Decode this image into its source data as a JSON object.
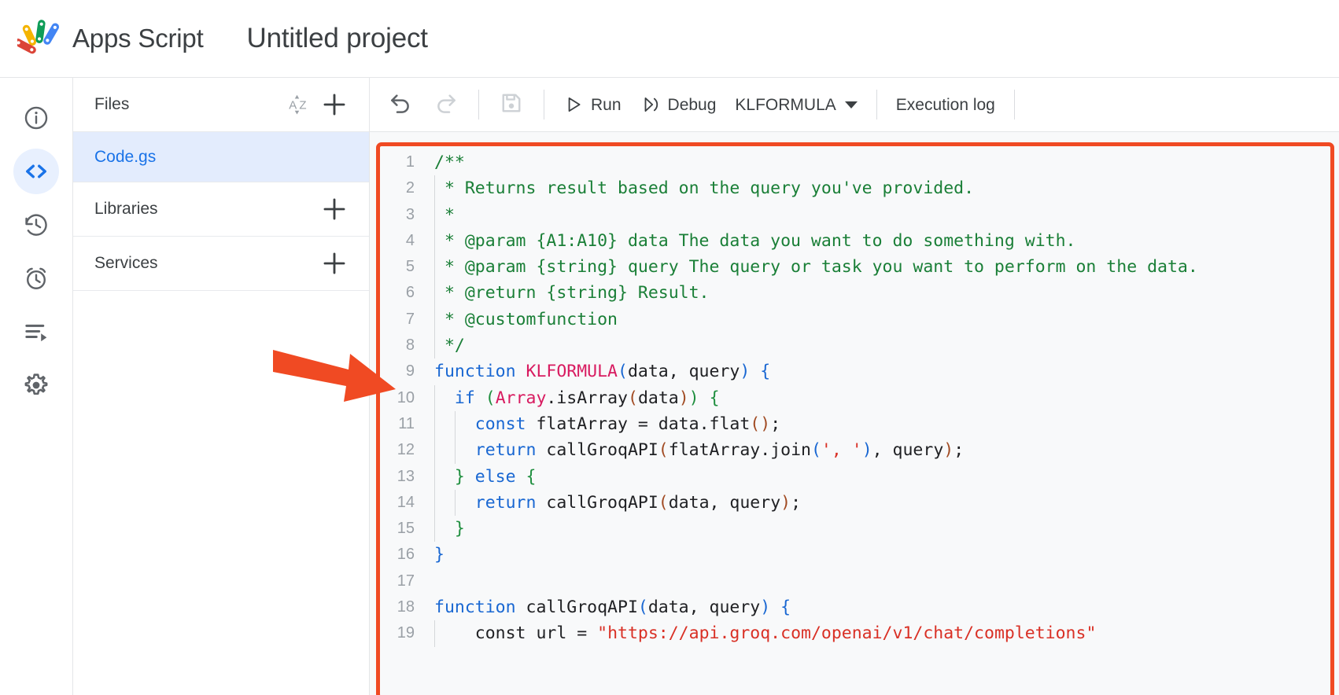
{
  "header": {
    "brand_name": "Apps Script",
    "project_title": "Untitled project",
    "logo_icon": "apps-script-logo"
  },
  "left_rail": {
    "items": [
      {
        "id": "overview",
        "icon": "info-circle-icon",
        "active": false
      },
      {
        "id": "editor",
        "icon": "code-brackets-icon",
        "active": true
      },
      {
        "id": "triggers",
        "icon": "history-clock-icon",
        "active": false
      },
      {
        "id": "executions",
        "icon": "alarm-clock-icon",
        "active": false
      },
      {
        "id": "logs",
        "icon": "list-play-icon",
        "active": false
      },
      {
        "id": "settings",
        "icon": "gear-icon",
        "active": false
      }
    ]
  },
  "files_panel": {
    "sections": [
      {
        "title": "Files",
        "sort_icon": "sort-az-icon",
        "add_icon": "plus-icon"
      },
      {
        "title": "Libraries",
        "add_icon": "plus-icon"
      },
      {
        "title": "Services",
        "add_icon": "plus-icon"
      }
    ],
    "files": [
      {
        "name": "Code.gs",
        "selected": true
      }
    ]
  },
  "toolbar": {
    "undo_icon": "undo-icon",
    "redo_icon": "redo-icon",
    "save_icon": "save-disk-icon",
    "run_label": "Run",
    "run_icon": "play-triangle-icon",
    "debug_label": "Debug",
    "debug_icon": "debug-bug-icon",
    "function_selected": "KLFORMULA",
    "execution_log_label": "Execution log"
  },
  "annotation": {
    "arrow_icon": "right-arrow-annotation",
    "arrow_color": "#f04a23",
    "highlight_box_color": "#f04a23"
  },
  "editor": {
    "language": "javascript",
    "filename": "Code.gs",
    "first_visible_line": 1,
    "lines": [
      {
        "n": 1,
        "indent": 0,
        "tokens": [
          {
            "t": "/**",
            "c": "comment"
          }
        ]
      },
      {
        "n": 2,
        "indent": 1,
        "tokens": [
          {
            "t": " * Returns result based on the query you've provided.",
            "c": "comment"
          }
        ]
      },
      {
        "n": 3,
        "indent": 1,
        "tokens": [
          {
            "t": " *",
            "c": "comment"
          }
        ]
      },
      {
        "n": 4,
        "indent": 1,
        "tokens": [
          {
            "t": " * @param {A1:A10} data The data you want to do something with.",
            "c": "comment"
          }
        ]
      },
      {
        "n": 5,
        "indent": 1,
        "tokens": [
          {
            "t": " * @param {string} query The query or task you want to perform on the data.",
            "c": "comment"
          }
        ]
      },
      {
        "n": 6,
        "indent": 1,
        "tokens": [
          {
            "t": " * @return {string} Result.",
            "c": "comment"
          }
        ]
      },
      {
        "n": 7,
        "indent": 1,
        "tokens": [
          {
            "t": " * @customfunction",
            "c": "comment"
          }
        ]
      },
      {
        "n": 8,
        "indent": 1,
        "tokens": [
          {
            "t": " */",
            "c": "comment"
          }
        ]
      },
      {
        "n": 9,
        "indent": 0,
        "tokens": [
          {
            "t": "function ",
            "c": "keyword"
          },
          {
            "t": "KLFORMULA",
            "c": "fnname"
          },
          {
            "t": "(",
            "c": "p-blue"
          },
          {
            "t": "data, query",
            "c": "plain"
          },
          {
            "t": ")",
            "c": "p-blue"
          },
          {
            "t": " ",
            "c": "plain"
          },
          {
            "t": "{",
            "c": "p-blue"
          }
        ]
      },
      {
        "n": 10,
        "indent": 1,
        "tokens": [
          {
            "t": "  ",
            "c": "plain"
          },
          {
            "t": "if",
            "c": "keyword"
          },
          {
            "t": " ",
            "c": "plain"
          },
          {
            "t": "(",
            "c": "p-green"
          },
          {
            "t": "Array",
            "c": "class"
          },
          {
            "t": ".isArray",
            "c": "plain"
          },
          {
            "t": "(",
            "c": "p-brown"
          },
          {
            "t": "data",
            "c": "plain"
          },
          {
            "t": ")",
            "c": "p-brown"
          },
          {
            "t": ")",
            "c": "p-green"
          },
          {
            "t": " ",
            "c": "plain"
          },
          {
            "t": "{",
            "c": "p-green"
          }
        ]
      },
      {
        "n": 11,
        "indent": 2,
        "tokens": [
          {
            "t": "    ",
            "c": "plain"
          },
          {
            "t": "const",
            "c": "keyword"
          },
          {
            "t": " flatArray = data.flat",
            "c": "plain"
          },
          {
            "t": "()",
            "c": "p-brown"
          },
          {
            "t": ";",
            "c": "plain"
          }
        ]
      },
      {
        "n": 12,
        "indent": 2,
        "tokens": [
          {
            "t": "    ",
            "c": "plain"
          },
          {
            "t": "return",
            "c": "keyword"
          },
          {
            "t": " callGroqAPI",
            "c": "plain"
          },
          {
            "t": "(",
            "c": "p-brown"
          },
          {
            "t": "flatArray.join",
            "c": "plain"
          },
          {
            "t": "(",
            "c": "p-blue"
          },
          {
            "t": "', '",
            "c": "string"
          },
          {
            "t": ")",
            "c": "p-blue"
          },
          {
            "t": ", query",
            "c": "plain"
          },
          {
            "t": ")",
            "c": "p-brown"
          },
          {
            "t": ";",
            "c": "plain"
          }
        ]
      },
      {
        "n": 13,
        "indent": 1,
        "tokens": [
          {
            "t": "  ",
            "c": "plain"
          },
          {
            "t": "}",
            "c": "p-green"
          },
          {
            "t": " ",
            "c": "plain"
          },
          {
            "t": "else",
            "c": "keyword"
          },
          {
            "t": " ",
            "c": "plain"
          },
          {
            "t": "{",
            "c": "p-green"
          }
        ]
      },
      {
        "n": 14,
        "indent": 2,
        "tokens": [
          {
            "t": "    ",
            "c": "plain"
          },
          {
            "t": "return",
            "c": "keyword"
          },
          {
            "t": " callGroqAPI",
            "c": "plain"
          },
          {
            "t": "(",
            "c": "p-brown"
          },
          {
            "t": "data, query",
            "c": "plain"
          },
          {
            "t": ")",
            "c": "p-brown"
          },
          {
            "t": ";",
            "c": "plain"
          }
        ]
      },
      {
        "n": 15,
        "indent": 1,
        "tokens": [
          {
            "t": "  ",
            "c": "plain"
          },
          {
            "t": "}",
            "c": "p-green"
          }
        ]
      },
      {
        "n": 16,
        "indent": 0,
        "tokens": [
          {
            "t": "}",
            "c": "p-blue"
          }
        ]
      },
      {
        "n": 17,
        "indent": 0,
        "tokens": [
          {
            "t": "",
            "c": "plain"
          }
        ]
      },
      {
        "n": 18,
        "indent": 0,
        "tokens": [
          {
            "t": "function ",
            "c": "keyword"
          },
          {
            "t": "callGroqAPI",
            "c": "plain"
          },
          {
            "t": "(",
            "c": "p-blue"
          },
          {
            "t": "data, query",
            "c": "plain"
          },
          {
            "t": ")",
            "c": "p-blue"
          },
          {
            "t": " ",
            "c": "plain"
          },
          {
            "t": "{",
            "c": "p-blue"
          }
        ]
      },
      {
        "n": 19,
        "indent": 1,
        "tokens": [
          {
            "t": "    ",
            "c": "plain"
          },
          {
            "t": "const url = ",
            "c": "plain"
          },
          {
            "t": "\"https://api.groq.com/openai/v1/chat/completions\"",
            "c": "string"
          }
        ]
      }
    ]
  }
}
